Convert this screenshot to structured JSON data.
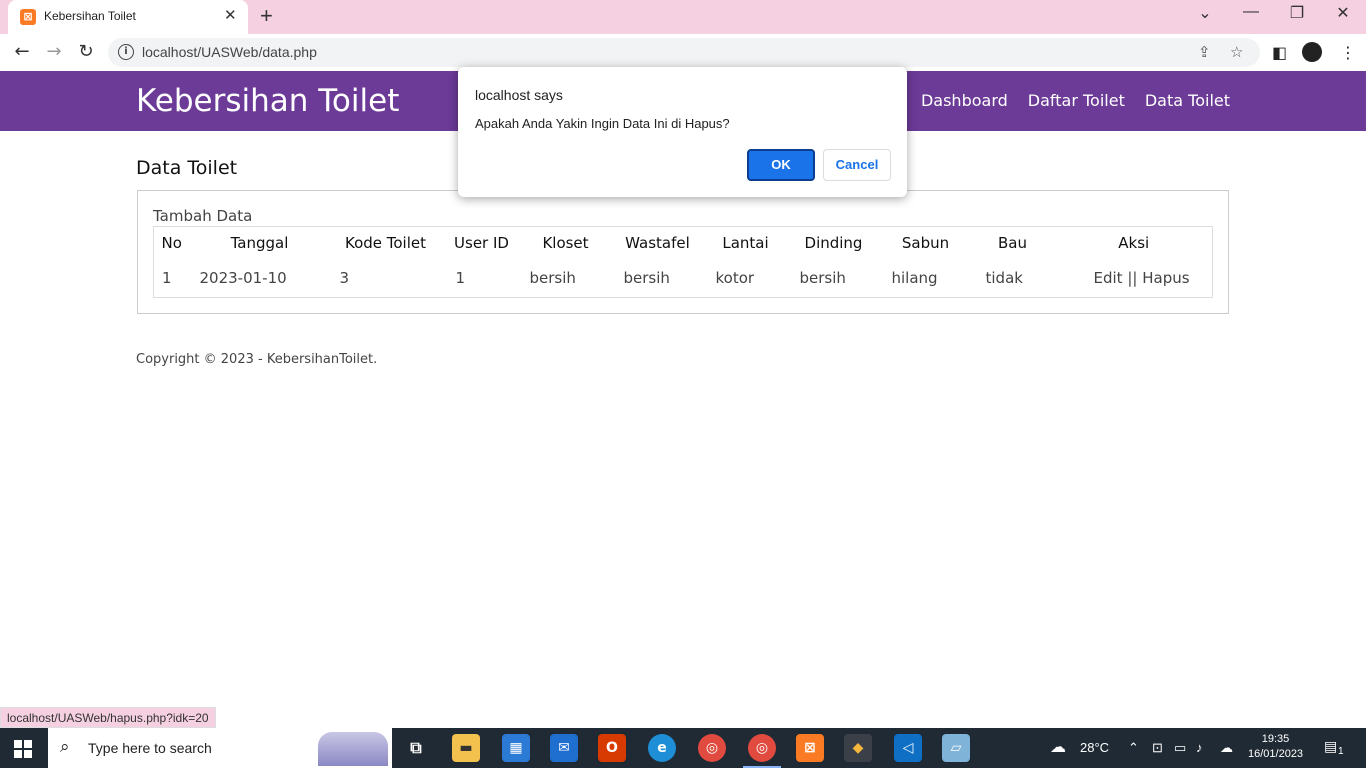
{
  "browser": {
    "tab_title": "Kebersihan Toilet",
    "url": "localhost/UASWeb/data.php",
    "status_url": "localhost/UASWeb/hapus.php?idk=20"
  },
  "site": {
    "title": "Kebersihan Toilet",
    "nav": [
      "Dashboard",
      "Daftar Toilet",
      "Data Toilet"
    ]
  },
  "main": {
    "page_title": "Data Toilet",
    "add_link": "Tambah Data",
    "columns": [
      "No",
      "Tanggal",
      "Kode Toilet",
      "User ID",
      "Kloset",
      "Wastafel",
      "Lantai",
      "Dinding",
      "Sabun",
      "Bau",
      "Aksi"
    ],
    "rows": [
      {
        "no": "1",
        "tanggal": "2023-01-10",
        "kode_toilet": "3",
        "user_id": "1",
        "kloset": "bersih",
        "wastafel": "bersih",
        "lantai": "kotor",
        "dinding": "bersih",
        "sabun": "hilang",
        "bau": "tidak",
        "edit": "Edit",
        "separator": "||",
        "hapus": "Hapus"
      }
    ]
  },
  "footer": "Copyright © 2023 - KebersihanToilet.",
  "dialog": {
    "title": "localhost says",
    "message": "Apakah Anda Yakin Ingin Data Ini di Hapus?",
    "ok": "OK",
    "cancel": "Cancel"
  },
  "taskbar": {
    "search_placeholder": "Type here to search",
    "weather": "28°C",
    "time": "19:35",
    "date": "16/01/2023",
    "notification_count": "1"
  },
  "colors": {
    "header": "#6c3a97",
    "tab_strip": "#f5d0e0",
    "primary_button": "#1a73e8",
    "taskbar": "#1f2a34"
  }
}
